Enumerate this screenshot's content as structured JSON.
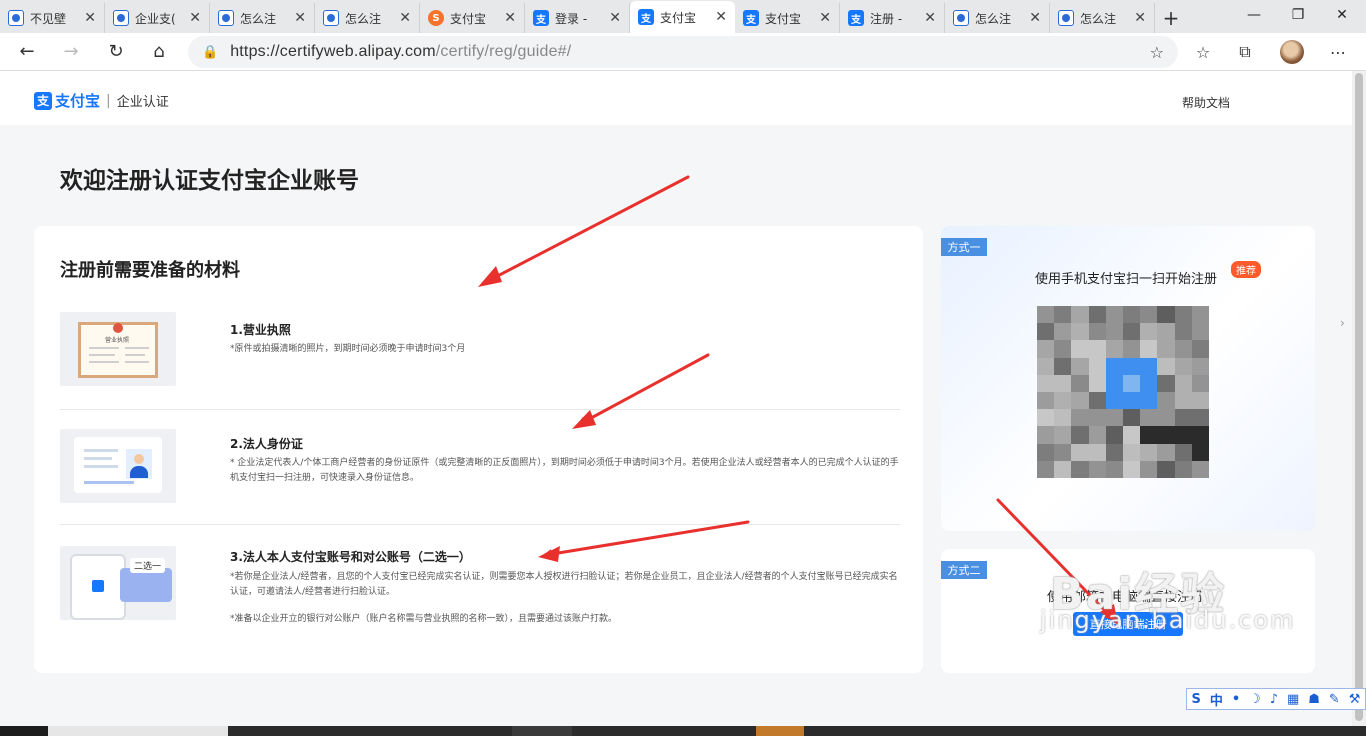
{
  "tabs": [
    {
      "title": "不见壁",
      "icon": "baidu",
      "active": false
    },
    {
      "title": "企业支(",
      "icon": "baidu",
      "active": false
    },
    {
      "title": "怎么注",
      "icon": "baidu",
      "active": false
    },
    {
      "title": "怎么注",
      "icon": "baidu",
      "active": false
    },
    {
      "title": "支付宝",
      "icon": "sogou",
      "active": false
    },
    {
      "title": "登录 - ",
      "icon": "alipay",
      "active": false
    },
    {
      "title": "支付宝",
      "icon": "alipay",
      "active": true
    },
    {
      "title": "支付宝",
      "icon": "alipay",
      "active": false
    },
    {
      "title": "注册 - ",
      "icon": "alipay",
      "active": false
    },
    {
      "title": "怎么注",
      "icon": "baidu",
      "active": false
    },
    {
      "title": "怎么注",
      "icon": "baidu",
      "active": false
    }
  ],
  "browser": {
    "url_host": "https://certifyweb.alipay.com",
    "url_path": "/certify/reg/guide#/",
    "tab_close": "✕",
    "new_tab": "+"
  },
  "header": {
    "logo_mark": "支",
    "brand": "支付宝",
    "sep": "|",
    "sub": "企业认证",
    "help": "帮助文档"
  },
  "main": {
    "page_title": "欢迎注册认证支付宝企业账号",
    "section_title": "注册前需要准备的材料",
    "items": [
      {
        "title": "1.营业执照",
        "desc": "*原件或拍摄清晰的照片，到期时间必须晚于申请时间3个月"
      },
      {
        "title": "2.法人身份证",
        "desc": "* 企业法定代表人/个体工商户经营者的身份证原件（或完整清晰的正反面照片），到期时间必须低于申请时间3个月。若使用企业法人或经营者本人的已完成个人认证的手机支付宝扫一扫注册，可快速录入身份证信息。"
      },
      {
        "title": "3.法人本人支付宝账号和对公账号（二选一）",
        "desc": "*若你是企业法人/经营者，且您的个人支付宝已经完成实名认证，则需要您本人授权进行扫脸认证；若你是企业员工，且企业法人/经营者的个人支付宝账号已经完成实名认证，可邀请法人/经营者进行扫脸认证。",
        "desc2": "*准备以企业开立的银行对公账户（账户名称需与营业执照的名称一致），且需要通过该账户打款。",
        "thumb_tag": "二选一"
      }
    ],
    "license_thumb_text": "营业执照"
  },
  "side": {
    "method1_badge": "方式一",
    "method1_title": "使用手机支付宝扫一扫开始注册",
    "recommend": "推荐",
    "method2_badge": "方式二",
    "method2_title": "使用邮箱在电脑端直接注册",
    "direct_btn": "直接电脑端注册"
  },
  "watermark": {
    "line1": "Bai经验",
    "line2": "jingyan.baidu.com"
  },
  "ime": {
    "items": [
      "S",
      "中",
      "•",
      "☽",
      "♪",
      "▦",
      "☗",
      "✎",
      "⚒"
    ]
  },
  "colors": {
    "brand_blue": "#1677ff",
    "badge_blue": "#4a90e2",
    "recommend_orange": "#ff5a2c",
    "arrow_red": "#e8302c"
  }
}
